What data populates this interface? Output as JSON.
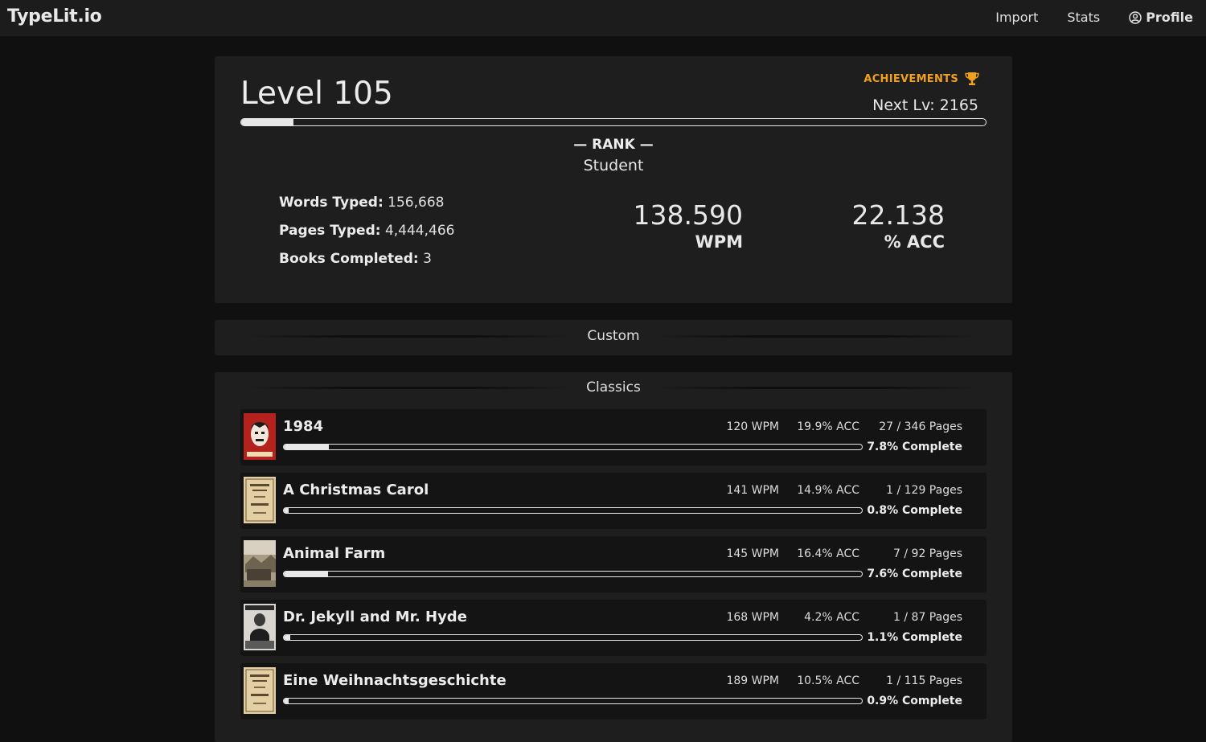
{
  "nav": {
    "brand": "TypeLit.io",
    "import": "Import",
    "stats": "Stats",
    "profile": "Profile"
  },
  "level_card": {
    "level_text": "Level 105",
    "achievements_label": "ACHIEVEMENTS",
    "next_level_text": "Next Lv: 2165",
    "level_progress": 0.07,
    "rank_title": "— RANK —",
    "rank_value": "Student",
    "words_typed_label": "Words Typed:",
    "words_typed_value": "156,668",
    "pages_typed_label": "Pages Typed:",
    "pages_typed_value": "4,444,466",
    "books_completed_label": "Books Completed:",
    "books_completed_value": "3",
    "wpm_value": "138.590",
    "wpm_unit": "WPM",
    "acc_value": "22.138",
    "acc_unit": "% ACC"
  },
  "sections": {
    "custom": "Custom",
    "classics": "Classics"
  },
  "books": [
    {
      "title": "1984",
      "wpm": "120 WPM",
      "acc": "19.9% ACC",
      "pages": "27 / 346 Pages",
      "complete": "7.8% Complete",
      "progress": 0.078,
      "cover": "cover-1984"
    },
    {
      "title": "A Christmas Carol",
      "wpm": "141 WPM",
      "acc": "14.9% ACC",
      "pages": "1 / 129 Pages",
      "complete": "0.8% Complete",
      "progress": 0.008,
      "cover": "cover-christmas-carol"
    },
    {
      "title": "Animal Farm",
      "wpm": "145 WPM",
      "acc": "16.4% ACC",
      "pages": "7 / 92 Pages",
      "complete": "7.6% Complete",
      "progress": 0.076,
      "cover": "cover-animal-farm"
    },
    {
      "title": "Dr. Jekyll and Mr. Hyde",
      "wpm": "168 WPM",
      "acc": "4.2% ACC",
      "pages": "1 / 87 Pages",
      "complete": "1.1% Complete",
      "progress": 0.011,
      "cover": "cover-jekyll-hyde"
    },
    {
      "title": "Eine Weihnachtsgeschichte",
      "wpm": "189 WPM",
      "acc": "10.5% ACC",
      "pages": "1 / 115 Pages",
      "complete": "0.9% Complete",
      "progress": 0.009,
      "cover": "cover-weihnachtsgeschichte"
    }
  ],
  "colors": {
    "accent": "#f0a020",
    "background": "#101010",
    "card": "#1e1e1e",
    "row": "#141414"
  }
}
